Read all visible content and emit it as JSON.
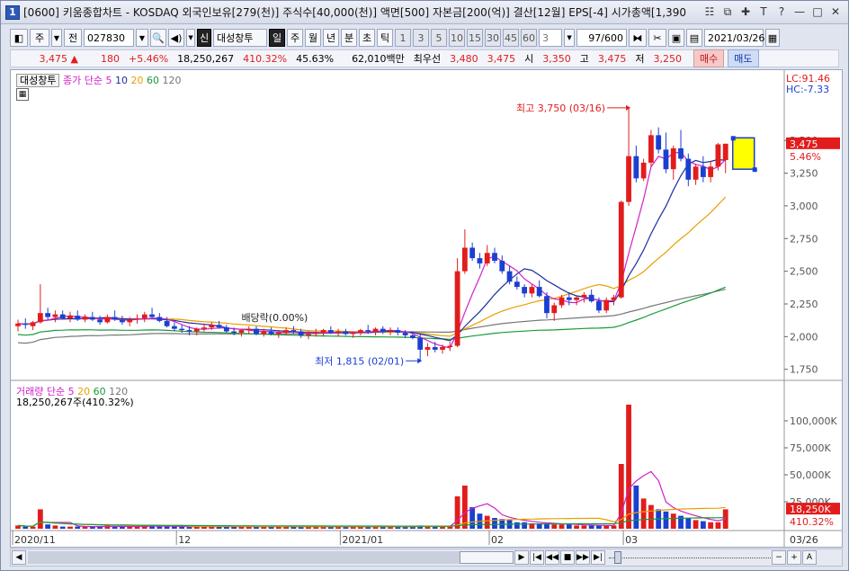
{
  "window": {
    "number": "1",
    "title": "[0600] 키움종합차트 - KOSDAQ 외국인보유[279(천)] 주식수[40,000(천)] 액면[500] 자본금[200(억)] 결산[12월] EPS[-4] 시가총액[1,390"
  },
  "toolbar": {
    "mode": "주",
    "prev_label": "전",
    "code": "027830",
    "stock_badge": "신",
    "stock_name": "대성창투",
    "periods": [
      "일",
      "주",
      "월",
      "년",
      "분",
      "초",
      "틱"
    ],
    "selected_period": "일",
    "intervals": [
      "1",
      "3",
      "5",
      "10",
      "15",
      "30",
      "45",
      "60"
    ],
    "interval_value": "3",
    "count": "97/600",
    "date": "2021/03/26"
  },
  "quote": {
    "price": "3,475",
    "change": "180",
    "change_pct": "+5.46%",
    "volume": "18,250,267",
    "vol_ratio": "410.32%",
    "turnover": "45.63%",
    "amount": "62,010백만",
    "best_bid_label": "최우선",
    "best_ask": "3,480",
    "best_bid": "3,475",
    "open_label": "시",
    "open": "3,350",
    "high_label": "고",
    "high": "3,475",
    "low_label": "저",
    "low": "3,250",
    "buy_label": "매수",
    "sell_label": "매도"
  },
  "price_legend": {
    "name": "대성창투",
    "ma_label": "종가 단순",
    "ma_periods": [
      "5",
      "10",
      "20",
      "60",
      "120"
    ],
    "lc": "LC:91.46",
    "hc": "HC:-7.33",
    "current_price": "3,475",
    "current_pct": "5.46%"
  },
  "volume_legend": {
    "label": "거래량",
    "ma_label": "단순",
    "ma_periods": [
      "5",
      "20",
      "60",
      "120"
    ],
    "value": "18,250,267주(410.32%)",
    "current": "18,250K",
    "current_pct": "410.32%"
  },
  "annotations": {
    "high": "최고 3,750 (03/16)",
    "low": "최저 1,815 (02/01)",
    "dividend": "배당락(0.00%)"
  },
  "x_labels": [
    "2020/11",
    "12",
    "2021/01",
    "02",
    "03",
    "03/26"
  ],
  "colors": {
    "up": "#e21c1c",
    "down": "#1b3fd1",
    "ma5": "#d020c8",
    "ma10": "#1b2fa0",
    "ma20": "#e8a000",
    "ma60": "#1a9a3a",
    "ma120": "#777777"
  },
  "chart_data": {
    "type": "candlestick",
    "price_axis": {
      "ticks": [
        "1,750",
        "2,000",
        "2,250",
        "2,500",
        "2,750",
        "3,000",
        "3,250",
        "3,500"
      ],
      "ylim": [
        1700,
        3900
      ]
    },
    "volume_axis": {
      "ticks": [
        "25,000K",
        "50,000K",
        "75,000K",
        "100,000K"
      ],
      "ylim": [
        0,
        125000
      ]
    },
    "candles": [
      [
        2080,
        2130,
        2040,
        2100,
        3
      ],
      [
        2100,
        2140,
        2060,
        2090,
        2
      ],
      [
        2080,
        2120,
        2050,
        2110,
        2
      ],
      [
        2110,
        2400,
        2100,
        2180,
        18
      ],
      [
        2180,
        2220,
        2130,
        2150,
        4
      ],
      [
        2150,
        2200,
        2110,
        2170,
        3
      ],
      [
        2170,
        2200,
        2130,
        2140,
        2
      ],
      [
        2140,
        2190,
        2110,
        2160,
        2
      ],
      [
        2160,
        2200,
        2120,
        2130,
        2
      ],
      [
        2130,
        2170,
        2110,
        2150,
        2
      ],
      [
        2150,
        2190,
        2120,
        2130,
        2
      ],
      [
        2130,
        2160,
        2090,
        2110,
        2
      ],
      [
        2110,
        2170,
        2100,
        2150,
        3
      ],
      [
        2150,
        2200,
        2120,
        2130,
        2
      ],
      [
        2130,
        2160,
        2090,
        2110,
        2
      ],
      [
        2110,
        2150,
        2080,
        2130,
        2
      ],
      [
        2130,
        2170,
        2100,
        2140,
        2
      ],
      [
        2140,
        2190,
        2110,
        2170,
        3
      ],
      [
        2170,
        2220,
        2140,
        2150,
        3
      ],
      [
        2150,
        2180,
        2110,
        2120,
        2
      ],
      [
        2120,
        2150,
        2070,
        2080,
        2
      ],
      [
        2080,
        2110,
        2040,
        2060,
        2
      ],
      [
        2060,
        2090,
        2030,
        2050,
        2
      ],
      [
        2050,
        2080,
        2010,
        2040,
        2
      ],
      [
        2040,
        2070,
        2010,
        2060,
        2
      ],
      [
        2060,
        2100,
        2040,
        2070,
        2
      ],
      [
        2070,
        2110,
        2050,
        2090,
        2
      ],
      [
        2090,
        2120,
        2060,
        2070,
        2
      ],
      [
        2070,
        2090,
        2030,
        2040,
        2
      ],
      [
        2040,
        2070,
        2010,
        2030,
        2
      ],
      [
        2030,
        2060,
        2000,
        2050,
        2
      ],
      [
        2050,
        2080,
        2020,
        2060,
        2
      ],
      [
        2060,
        2080,
        2010,
        2020,
        2
      ],
      [
        2020,
        2060,
        2000,
        2040,
        2
      ],
      [
        2040,
        2070,
        2010,
        2020,
        2
      ],
      [
        2020,
        2050,
        1990,
        2030,
        2
      ],
      [
        2030,
        2070,
        2010,
        2050,
        2
      ],
      [
        2050,
        2080,
        2020,
        2040,
        2
      ],
      [
        2040,
        2060,
        1990,
        2010,
        2
      ],
      [
        2010,
        2040,
        1980,
        2020,
        2
      ],
      [
        2020,
        2060,
        2000,
        2030,
        2
      ],
      [
        2030,
        2060,
        2000,
        2050,
        2
      ],
      [
        2050,
        2080,
        2020,
        2030,
        2
      ],
      [
        2030,
        2060,
        2000,
        2040,
        2
      ],
      [
        2040,
        2060,
        2010,
        2020,
        2
      ],
      [
        2020,
        2040,
        1990,
        2030,
        2
      ],
      [
        2030,
        2060,
        2010,
        2050,
        2
      ],
      [
        2050,
        2090,
        2020,
        2040,
        2
      ],
      [
        2040,
        2070,
        2010,
        2060,
        2
      ],
      [
        2060,
        2080,
        2020,
        2040,
        2
      ],
      [
        2040,
        2070,
        2010,
        2050,
        2
      ],
      [
        2050,
        2070,
        2010,
        2030,
        2
      ],
      [
        2030,
        2050,
        1990,
        2010,
        2
      ],
      [
        2010,
        2040,
        1980,
        1990,
        2
      ],
      [
        1990,
        2020,
        1815,
        1900,
        3
      ],
      [
        1900,
        1950,
        1850,
        1920,
        2
      ],
      [
        1920,
        1960,
        1880,
        1900,
        2
      ],
      [
        1900,
        1940,
        1870,
        1920,
        2
      ],
      [
        1920,
        1960,
        1890,
        1930,
        2
      ],
      [
        1930,
        2600,
        1920,
        2500,
        30
      ],
      [
        2500,
        2820,
        2480,
        2680,
        40
      ],
      [
        2680,
        2720,
        2580,
        2600,
        20
      ],
      [
        2600,
        2640,
        2520,
        2560,
        14
      ],
      [
        2560,
        2700,
        2540,
        2640,
        12
      ],
      [
        2640,
        2680,
        2560,
        2580,
        10
      ],
      [
        2580,
        2620,
        2480,
        2500,
        9
      ],
      [
        2500,
        2540,
        2400,
        2420,
        8
      ],
      [
        2420,
        2460,
        2360,
        2380,
        6
      ],
      [
        2380,
        2400,
        2300,
        2330,
        6
      ],
      [
        2330,
        2400,
        2300,
        2380,
        5
      ],
      [
        2380,
        2430,
        2300,
        2310,
        5
      ],
      [
        2310,
        2340,
        2140,
        2180,
        5
      ],
      [
        2180,
        2260,
        2120,
        2240,
        4
      ],
      [
        2240,
        2320,
        2220,
        2300,
        4
      ],
      [
        2300,
        2340,
        2240,
        2280,
        4
      ],
      [
        2280,
        2310,
        2240,
        2300,
        3
      ],
      [
        2300,
        2340,
        2260,
        2320,
        3
      ],
      [
        2320,
        2360,
        2260,
        2270,
        3
      ],
      [
        2270,
        2300,
        2180,
        2200,
        3
      ],
      [
        2200,
        2300,
        2180,
        2280,
        3
      ],
      [
        2280,
        2320,
        2240,
        2300,
        3
      ],
      [
        2300,
        3040,
        2290,
        3030,
        60
      ],
      [
        3030,
        3750,
        3000,
        3380,
        115
      ],
      [
        3380,
        3460,
        3180,
        3210,
        40
      ],
      [
        3210,
        3360,
        3190,
        3330,
        28
      ],
      [
        3330,
        3580,
        3300,
        3540,
        22
      ],
      [
        3540,
        3600,
        3400,
        3430,
        18
      ],
      [
        3430,
        3560,
        3250,
        3280,
        16
      ],
      [
        3280,
        3460,
        3200,
        3440,
        14
      ],
      [
        3440,
        3580,
        3340,
        3360,
        12
      ],
      [
        3360,
        3400,
        3150,
        3200,
        10
      ],
      [
        3200,
        3320,
        3160,
        3300,
        8
      ],
      [
        3300,
        3380,
        3180,
        3220,
        7
      ],
      [
        3220,
        3340,
        3180,
        3300,
        6
      ],
      [
        3300,
        3480,
        3270,
        3470,
        6
      ],
      [
        3350,
        3475,
        3250,
        3475,
        18
      ]
    ],
    "markers": {
      "high_value": 3750,
      "low_value": 1815
    }
  }
}
